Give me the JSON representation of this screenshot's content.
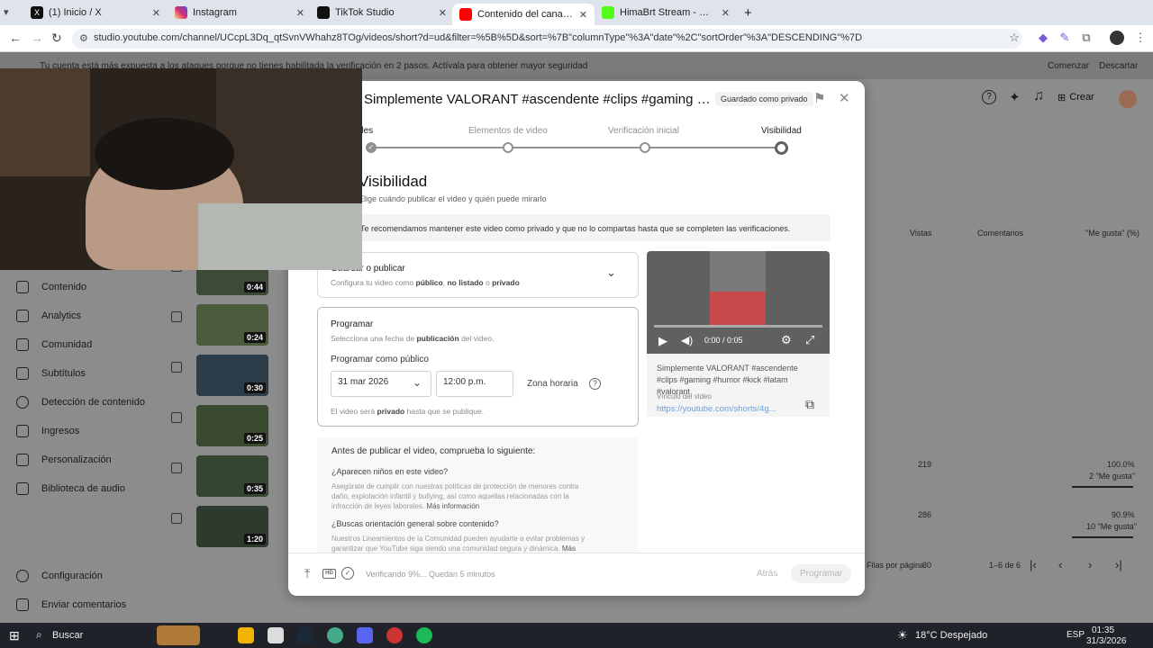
{
  "browser": {
    "tabs": [
      {
        "label": "(1) Inicio / X",
        "color": "#111111"
      },
      {
        "label": "Instagram",
        "color": "#d6249f"
      },
      {
        "label": "TikTok Studio",
        "color": "#111111"
      },
      {
        "label": "Contenido del canal - YouTube",
        "color": "#ff0000"
      },
      {
        "label": "HimaBrt Stream - Watch Live o",
        "color": "#53fc18"
      }
    ],
    "new_tab": "+",
    "url": "studio.youtube.com/channel/UCcpL3Dq_qtSvnVWhahz8TOg/videos/short?d=ud&filter=%5B%5D&sort=%7B\"columnType\"%3A\"date\"%2C\"sortOrder\"%3A\"DESCENDING\"%7D"
  },
  "warning": {
    "text": "Tu cuenta está más expuesta a los ataques porque no tienes habilitada la verificación en 2 pasos. Actívala para obtener mayor seguridad",
    "start": "Comenzar",
    "dismiss": "Descartar"
  },
  "studio_header": {
    "create": "Crear"
  },
  "sidebar": {
    "items": [
      {
        "label": "Contenido",
        "icon": "content-icon"
      },
      {
        "label": "Analytics",
        "icon": "analytics-icon"
      },
      {
        "label": "Comunidad",
        "icon": "community-icon"
      },
      {
        "label": "Subtítulos",
        "icon": "subtitles-icon"
      },
      {
        "label": "Detección de contenido",
        "icon": "copyright-icon"
      },
      {
        "label": "Ingresos",
        "icon": "money-icon"
      },
      {
        "label": "Personalización",
        "icon": "customize-icon"
      },
      {
        "label": "Biblioteca de audio",
        "icon": "audio-icon"
      }
    ],
    "settings": "Configuración",
    "feedback": "Enviar comentarios"
  },
  "videos": [
    {
      "duration": "0:44"
    },
    {
      "duration": "0:24"
    },
    {
      "duration": "0:30"
    },
    {
      "duration": "0:25"
    },
    {
      "duration": "0:35"
    },
    {
      "duration": "1:20"
    }
  ],
  "table": {
    "headers": [
      "Vistas",
      "Comentarios",
      "\"Me gusta\" (%)"
    ],
    "row_a": {
      "views": "219",
      "likes_pct": "100.0%",
      "likes_count": "2 \"Me gusta\""
    },
    "row_b": {
      "views": "286",
      "likes_pct": "90.9%",
      "likes_count": "10 \"Me gusta\""
    },
    "pagination": {
      "per_page_label": "Filas por página",
      "per_page": "30",
      "range": "1–6 de 6"
    }
  },
  "modal": {
    "title": "Simplemente VALORANT #ascendente #clips #gaming #humor #kick #latam #valorant",
    "saved_badge": "Guardado como privado",
    "steps": [
      "Detalles",
      "Elementos de video",
      "Verificación inicial",
      "Visibilidad"
    ],
    "section_title": "Visibilidad",
    "section_subtitle": "Elige cuándo publicar el video y quién puede mirarlo",
    "notice": "Te recomendamos mantener este video como privado y que no lo compartas hasta que se completen las verificaciones.",
    "save_publish": {
      "title": "Guardar o publicar",
      "subtitle_pre": "Configura tu video como ",
      "opt1": "público",
      "sep1": ", ",
      "opt2": "no listado",
      "sep2": " o ",
      "opt3": "privado"
    },
    "schedule": {
      "title": "Programar",
      "subtitle_pre": "Selecciona una fecha de ",
      "subtitle_bold": "publicación",
      "subtitle_post": " del video.",
      "schedule_as": "Programar como público",
      "date": "31 mar 2026",
      "time": "12:00 p.m.",
      "timezone": "Zona horaria",
      "note_pre": "El video será ",
      "note_bold": "privado",
      "note_post": " hasta que se publique."
    },
    "player": {
      "time": "0:00 / 0:05"
    },
    "video_info": {
      "title": "Simplemente VALORANT #ascendente #clips #gaming #humor #kick #latam #valorant",
      "link_label": "Vínculo del video",
      "link": "https://youtube.com/shorts/4g..."
    },
    "checklist": {
      "title": "Antes de publicar el video, comprueba lo siguiente:",
      "q1": "¿Aparecen niños en este video?",
      "a1": "Asegúrate de cumplir con nuestras políticas de protección de menores contra daño, explotación infantil y bullying, así como aquellas relacionadas con la infracción de leyes laborales.",
      "more1": "Más información",
      "q2": "¿Buscas orientación general sobre contenido?",
      "a2": "Nuestros Lineamientos de la Comunidad pueden ayudarte a evitar problemas y garantizar que YouTube siga siendo una comunidad segura y dinámica.",
      "more2": "Más"
    },
    "footer": {
      "status": "Verificando 9%... Quedan 5 minutos",
      "back": "Atrás",
      "schedule": "Programar"
    }
  },
  "taskbar": {
    "search": "Buscar",
    "weather": "18°C Despejado",
    "lang": "ESP",
    "time": "01:35",
    "date": "31/3/2026"
  }
}
